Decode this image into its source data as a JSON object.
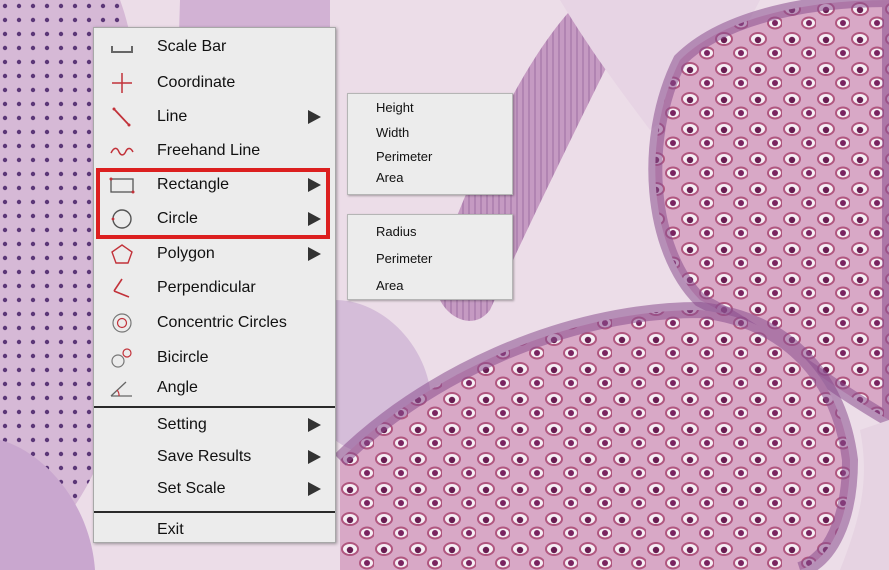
{
  "menu": {
    "items": [
      {
        "label": "Scale Bar",
        "icon": "scale-bar-icon",
        "submenu": false
      },
      {
        "label": "Coordinate",
        "icon": "crosshair-icon",
        "submenu": false
      },
      {
        "label": "Line",
        "icon": "line-icon",
        "submenu": true
      },
      {
        "label": "Freehand Line",
        "icon": "freehand-line-icon",
        "submenu": false
      },
      {
        "label": "Rectangle",
        "icon": "rectangle-icon",
        "submenu": true
      },
      {
        "label": "Circle",
        "icon": "circle-icon",
        "submenu": true
      },
      {
        "label": "Polygon",
        "icon": "polygon-icon",
        "submenu": true
      },
      {
        "label": "Perpendicular",
        "icon": "perpendicular-icon",
        "submenu": false
      },
      {
        "label": "Concentric Circles",
        "icon": "concentric-circles-icon",
        "submenu": false
      },
      {
        "label": "Bicircle",
        "icon": "bicircle-icon",
        "submenu": false
      },
      {
        "label": "Angle",
        "icon": "angle-icon",
        "submenu": false
      }
    ],
    "settings_items": [
      {
        "label": "Setting",
        "submenu": true
      },
      {
        "label": "Save Results",
        "submenu": true
      },
      {
        "label": "Set Scale",
        "submenu": true
      }
    ],
    "exit_label": "Exit"
  },
  "rectangle_submenu": [
    "Height",
    "Width",
    "Perimeter",
    "Area"
  ],
  "circle_submenu": [
    "Radius",
    "Perimeter",
    "Area"
  ],
  "colors": {
    "highlight": "#dc1f1f",
    "icon": "#c2323a",
    "menu_bg": "#ececec"
  }
}
